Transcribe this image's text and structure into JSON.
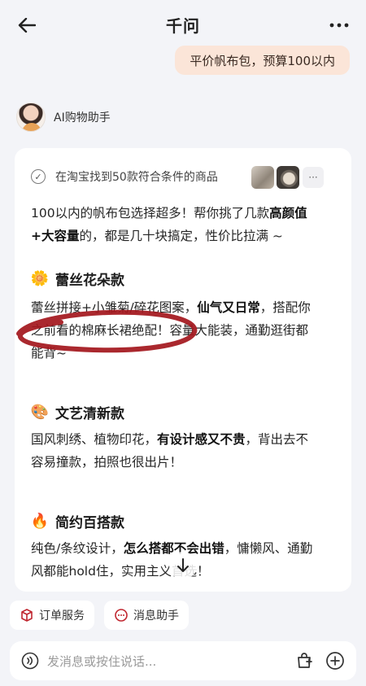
{
  "header": {
    "title": "千问"
  },
  "user_message": "平价帆布包，预算100以内",
  "assistant": {
    "name": "AI购物助手"
  },
  "card": {
    "found_text": "在淘宝找到50款符合条件的商品",
    "intro_line1_a": "100以内的帆布包选择超多！帮你挑了几款",
    "intro_line1_b": "高颜值",
    "intro_line2_a": "+大容量",
    "intro_line2_b": "的，都是几十块搞定，性价比拉满 ~",
    "sections": [
      {
        "title": "蕾丝花朵款",
        "line1_a": "蕾丝拼接+小雏菊/碎花图案，",
        "line1_b": "仙气又日常",
        "line1_c": "，搭配你",
        "line2": "之前看的棉麻长裙绝配！容量大能装，通勤逛街都",
        "line3": "能背~"
      },
      {
        "title": "文艺清新款",
        "line1_a": "国风刺绣、植物印花，",
        "line1_b": "有设计感又不贵",
        "line1_c": "，背出去不",
        "line2": "容易撞款，拍照也很出片！"
      },
      {
        "title": "简约百搭款",
        "line1_a": "纯色/条纹设计，",
        "line1_b": "怎么搭都不会出错",
        "line1_c": "，慵懒风、通勤",
        "line2": "风都能hold住，实用主义首选！"
      }
    ]
  },
  "quick_actions": [
    "订单服务",
    "消息助手"
  ],
  "input": {
    "placeholder": "发消息或按住说话..."
  },
  "colors": {
    "user_bubble": "#fbe5d8",
    "scribble": "#a3161c",
    "background": "#f3f4f8"
  }
}
